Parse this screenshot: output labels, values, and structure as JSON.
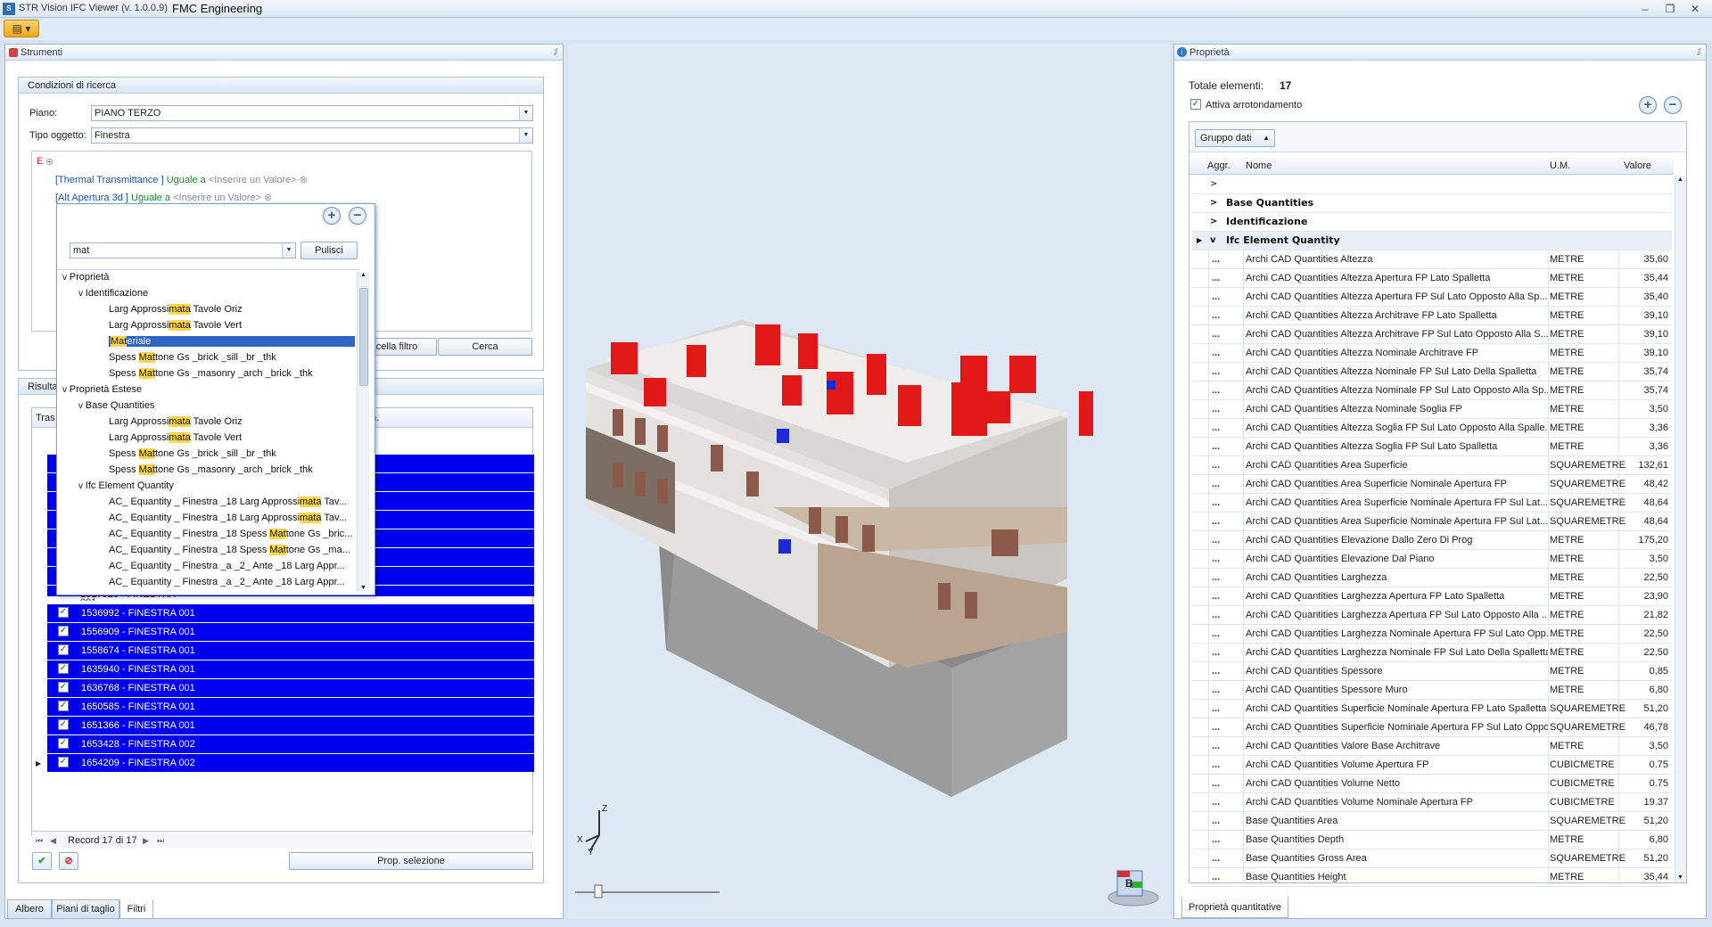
{
  "app": {
    "title": "STR Vision IFC Viewer (v. 1.0.0.9)",
    "company": "FMC Engineering"
  },
  "left": {
    "panel_title": "Strumenti",
    "search": {
      "group_title": "Condizioni di ricerca",
      "piano_label": "Piano:",
      "piano_value": "PIANO TERZO",
      "tipo_label": "Tipo oggetto:",
      "tipo_value": "Finestra",
      "root": "E",
      "conditions": [
        {
          "field": "[Thermal Transmittance ]",
          "op": "Uguale a",
          "value": "<Inserire un Valore>"
        },
        {
          "field": "[Alt Apertura 3d ]",
          "op": "Uguale a",
          "value": "<Inserire un Valore>"
        }
      ],
      "cancel_filter": "cella filtro",
      "search_btn": "Cerca"
    },
    "popup": {
      "query": "mat",
      "clear_btn": "Pulisci",
      "items": [
        {
          "text": "Proprietà",
          "level": 0,
          "arrow": "v"
        },
        {
          "text": "Identificazione",
          "level": 1,
          "arrow": "v"
        },
        {
          "pre": "Larg Approssi",
          "hl": "mata",
          "post": " Tavole Oriz",
          "level": 2
        },
        {
          "pre": "Larg Approssi",
          "hl": "mata",
          "post": " Tavole Vert",
          "level": 2
        },
        {
          "pre": "",
          "hl": "Mat",
          "post": "eriale",
          "level": 2,
          "selected": true
        },
        {
          "pre": "Spess ",
          "hl": "Mat",
          "post": "tone Gs _brick _sill _br _thk",
          "level": 2
        },
        {
          "pre": "Spess ",
          "hl": "Mat",
          "post": "tone Gs _masonry _arch _brick _thk",
          "level": 2
        },
        {
          "text": "Proprietà Estese",
          "level": 0,
          "arrow": "v"
        },
        {
          "text": "Base Quantities",
          "level": 1,
          "arrow": "v"
        },
        {
          "pre": "Larg Approssi",
          "hl": "mata",
          "post": " Tavole Oriz",
          "level": 2
        },
        {
          "pre": "Larg Approssi",
          "hl": "mata",
          "post": " Tavole Vert",
          "level": 2
        },
        {
          "pre": "Spess ",
          "hl": "Mat",
          "post": "tone Gs _brick _sill _br _thk",
          "level": 2
        },
        {
          "pre": "Spess ",
          "hl": "Mat",
          "post": "tone Gs _masonry _arch _brick _thk",
          "level": 2
        },
        {
          "text": "Ifc Element Quantity",
          "level": 1,
          "arrow": "v"
        },
        {
          "pre": "AC_ Equantity _ Finestra _18 Larg Approssi",
          "hl": "mata",
          "post": " Tav...",
          "level": 2
        },
        {
          "pre": "AC_ Equantity _ Finestra _18 Larg Approssi",
          "hl": "mata",
          "post": " Tav...",
          "level": 2
        },
        {
          "pre": "AC_ Equantity _ Finestra _18 Spess ",
          "hl": "Mat",
          "post": "tone Gs _bric...",
          "level": 2
        },
        {
          "pre": "AC_ Equantity _ Finestra _18 Spess ",
          "hl": "Mat",
          "post": "tone Gs _ma...",
          "level": 2
        },
        {
          "pre": "AC_ Equantity _ Finestra _a _2_ Ante _18 Larg Appr...",
          "hl": "",
          "post": "",
          "level": 2
        },
        {
          "pre": "AC_ Equantity _ Finestra _a _2_ Ante _18 Larg Appr...",
          "hl": "",
          "post": "",
          "level": 2
        }
      ]
    },
    "results": {
      "group_title": "Risulta",
      "col_header": "Tras",
      "col_header2": "n.",
      "partial_row": "1517020 - FINESTRA 001",
      "rows": [
        "1536992 - FINESTRA 001",
        "1556909 - FINESTRA 001",
        "1558674 - FINESTRA 001",
        "1635940 - FINESTRA 001",
        "1636768 - FINESTRA 001",
        "1650585 - FINESTRA 001",
        "1651366 - FINESTRA 001",
        "1653428 - FINESTRA 002",
        "1654209 - FINESTRA 002"
      ],
      "record": "Record 17 di 17",
      "prop_btn": "Prop. selezione"
    },
    "tabs": [
      "Albero",
      "Piani di taglio",
      "Filtri"
    ]
  },
  "viewer": {
    "axis_z": "Z",
    "axis_x": "X",
    "axis_y": "Y",
    "cube_label": "B"
  },
  "right": {
    "panel_title": "Proprietà",
    "total_label": "Totale elementi:",
    "total_value": "17",
    "round_label": "Attiva arrotondamento",
    "group_btn": "Gruppo dati",
    "columns": {
      "agg": "Aggr.",
      "name": "Nome",
      "um": "U.M.",
      "value": "Valore"
    },
    "groups": [
      "Base Quantities",
      "Identificazione",
      "Ifc Element Quantity"
    ],
    "rows": [
      {
        "n": "Archi CAD Quantities Altezza",
        "u": "METRE",
        "v": "35,60"
      },
      {
        "n": "Archi CAD Quantities Altezza Apertura FP Lato Spalletta",
        "u": "METRE",
        "v": "35,44"
      },
      {
        "n": "Archi CAD Quantities Altezza Apertura FP Sul Lato Opposto Alla Sp...",
        "u": "METRE",
        "v": "35,40"
      },
      {
        "n": "Archi CAD Quantities Altezza Architrave FP Lato Spalletta",
        "u": "METRE",
        "v": "39,10"
      },
      {
        "n": "Archi CAD Quantities Altezza Architrave FP Sul Lato Opposto Alla S...",
        "u": "METRE",
        "v": "39,10"
      },
      {
        "n": "Archi CAD Quantities Altezza Nominale Architrave FP",
        "u": "METRE",
        "v": "39,10"
      },
      {
        "n": "Archi CAD Quantities Altezza Nominale FP Sul Lato Della Spalletta",
        "u": "METRE",
        "v": "35,74"
      },
      {
        "n": "Archi CAD Quantities Altezza Nominale FP Sul Lato Opposto Alla Sp...",
        "u": "METRE",
        "v": "35,74"
      },
      {
        "n": "Archi CAD Quantities Altezza Nominale Soglia FP",
        "u": "METRE",
        "v": "3,50"
      },
      {
        "n": "Archi CAD Quantities Altezza Soglia FP Sul Lato Opposto Alla Spalle...",
        "u": "METRE",
        "v": "3,36"
      },
      {
        "n": "Archi CAD Quantities Altezza Soglia FP Sul Lato Spalletta",
        "u": "METRE",
        "v": "3,36"
      },
      {
        "n": "Archi CAD Quantities Area Superficie",
        "u": "SQUAREMETRE",
        "v": "132,61"
      },
      {
        "n": "Archi CAD Quantities Area Superficie Nominale Apertura FP",
        "u": "SQUAREMETRE",
        "v": "48,42"
      },
      {
        "n": "Archi CAD Quantities Area Superficie Nominale Apertura FP Sul Lat...",
        "u": "SQUAREMETRE",
        "v": "48,64"
      },
      {
        "n": "Archi CAD Quantities Area Superficie Nominale Apertura FP Sul Lat...",
        "u": "SQUAREMETRE",
        "v": "48,64"
      },
      {
        "n": "Archi CAD Quantities Elevazione Dallo Zero Di Prog",
        "u": "METRE",
        "v": "175,20"
      },
      {
        "n": "Archi CAD Quantities Elevazione Dal Piano",
        "u": "METRE",
        "v": "3,50"
      },
      {
        "n": "Archi CAD Quantities Larghezza",
        "u": "METRE",
        "v": "22,50"
      },
      {
        "n": "Archi CAD Quantities Larghezza Apertura FP Lato Spalletta",
        "u": "METRE",
        "v": "23,90"
      },
      {
        "n": "Archi CAD Quantities Larghezza Apertura FP Sul Lato Opposto Alla ...",
        "u": "METRE",
        "v": "21,82"
      },
      {
        "n": "Archi CAD Quantities Larghezza Nominale Apertura FP Sul Lato Opp...",
        "u": "METRE",
        "v": "22,50"
      },
      {
        "n": "Archi CAD Quantities Larghezza Nominale FP Sul Lato Della Spalletta",
        "u": "METRE",
        "v": "22,50"
      },
      {
        "n": "Archi CAD Quantities Spessore",
        "u": "METRE",
        "v": "0,85"
      },
      {
        "n": "Archi CAD Quantities Spessore Muro",
        "u": "METRE",
        "v": "6,80"
      },
      {
        "n": "Archi CAD Quantities Superficie Nominale Apertura FP Lato Spalletta",
        "u": "SQUAREMETRE",
        "v": "51,20"
      },
      {
        "n": "Archi CAD Quantities Superficie Nominale Apertura FP Sul Lato Opposto Alla ...",
        "u": "SQUAREMETRE",
        "v": "46,78"
      },
      {
        "n": "Archi CAD Quantities Valore Base Architrave",
        "u": "METRE",
        "v": "3,50"
      },
      {
        "n": "Archi CAD Quantities Volume Apertura FP",
        "u": "CUBICMETRE",
        "v": "0.75"
      },
      {
        "n": "Archi CAD Quantities Volume Netto",
        "u": "CUBICMETRE",
        "v": "0.75"
      },
      {
        "n": "Archi CAD Quantities Volume Nominale Apertura FP",
        "u": "CUBICMETRE",
        "v": "19.37"
      },
      {
        "n": "Base Quantities Area",
        "u": "SQUAREMETRE",
        "v": "51,20"
      },
      {
        "n": "Base Quantities Depth",
        "u": "METRE",
        "v": "6,80"
      },
      {
        "n": "Base Quantities Gross Area",
        "u": "SQUAREMETRE",
        "v": "51,20"
      },
      {
        "n": "Base Quantities Height",
        "u": "METRE",
        "v": "35,44"
      }
    ],
    "bottom_tab": "Proprietà quantitative"
  }
}
